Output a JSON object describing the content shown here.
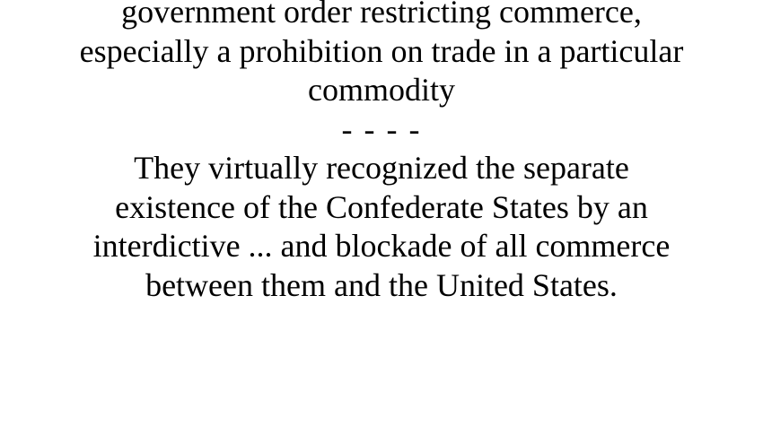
{
  "definition": {
    "lines": [
      "government order restricting commerce,",
      "especially a prohibition on trade in a particular",
      "commodity"
    ]
  },
  "separator": "- - - -",
  "example": {
    "lines": [
      "They virtually recognized the separate",
      "existence of the Confederate States by an",
      "interdictive ... and blockade of all commerce",
      "between them and the United States."
    ]
  }
}
